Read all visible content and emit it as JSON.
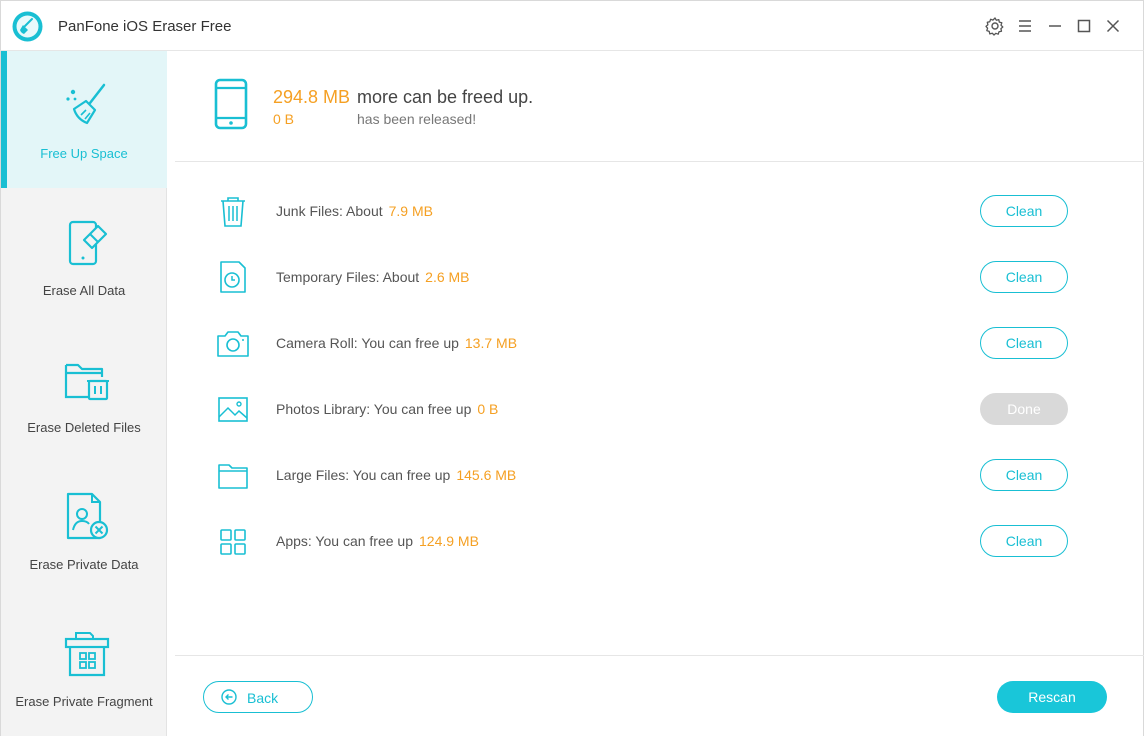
{
  "window": {
    "title": "PanFone iOS Eraser Free",
    "controls": [
      "settings-icon",
      "menu-icon",
      "minimize-icon",
      "maximize-icon",
      "close-icon"
    ]
  },
  "sidebar": {
    "items": [
      {
        "label": "Free Up Space",
        "icon": "broom-icon",
        "active": true
      },
      {
        "label": "Erase All Data",
        "icon": "phone-eraser-icon",
        "active": false
      },
      {
        "label": "Erase Deleted Files",
        "icon": "folder-trash-icon",
        "active": false
      },
      {
        "label": "Erase Private Data",
        "icon": "user-document-icon",
        "active": false
      },
      {
        "label": "Erase Private Fragment",
        "icon": "house-grid-icon",
        "active": false
      }
    ]
  },
  "summary": {
    "freeable_amount": "294.8 MB",
    "freeable_text": "more can be freed up.",
    "released_amount": "0 B",
    "released_text": "has been released!"
  },
  "items": [
    {
      "label": "Junk Files: About",
      "value": "7.9 MB",
      "button": "Clean",
      "icon": "trash-icon"
    },
    {
      "label": "Temporary Files: About",
      "value": "2.6 MB",
      "button": "Clean",
      "icon": "clock-file-icon"
    },
    {
      "label": "Camera Roll: You can free up",
      "value": "13.7 MB",
      "button": "Clean",
      "icon": "camera-icon"
    },
    {
      "label": "Photos Library: You can free up",
      "value": "0 B",
      "button": "Done",
      "icon": "image-icon"
    },
    {
      "label": "Large Files: You can free up",
      "value": "145.6 MB",
      "button": "Clean",
      "icon": "folder-icon"
    },
    {
      "label": "Apps: You can free up",
      "value": "124.9 MB",
      "button": "Clean",
      "icon": "apps-grid-icon"
    }
  ],
  "footer": {
    "back_label": "Back",
    "rescan_label": "Rescan"
  },
  "colors": {
    "accent": "#19bfd3",
    "highlight": "#f5a023",
    "active_bg": "#e3f6f8",
    "done_bg": "#d9d9d9"
  }
}
